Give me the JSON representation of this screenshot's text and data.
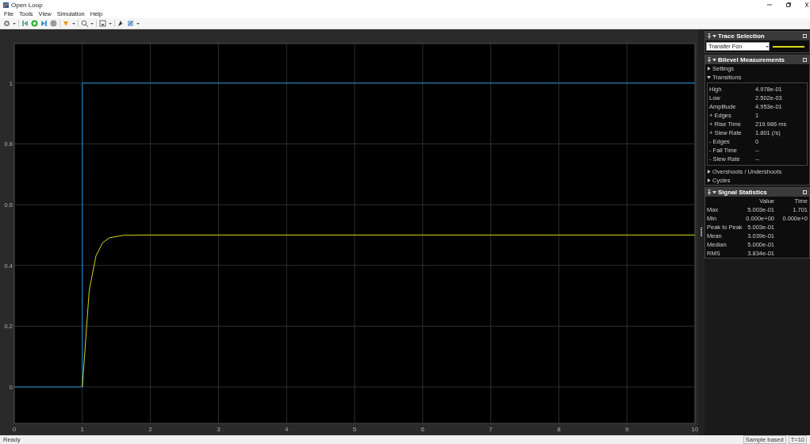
{
  "window": {
    "title": "Open Loop"
  },
  "menu": [
    "File",
    "Tools",
    "View",
    "Simulation",
    "Help"
  ],
  "plot": {
    "chart_data": {
      "type": "line",
      "grid": true,
      "x": [
        0,
        0.999,
        1,
        1.1,
        1.2,
        1.3,
        1.4,
        1.6,
        2,
        10
      ],
      "xlim": [
        0,
        10
      ],
      "ylim": [
        -0.12,
        1.13
      ],
      "xticks": [
        0,
        1,
        2,
        3,
        4,
        5,
        6,
        7,
        8,
        9,
        10
      ],
      "yticks": [
        0,
        0.2,
        0.4,
        0.6,
        0.8,
        1
      ],
      "series": [
        {
          "color": "#1f8fd8",
          "values": [
            0,
            0,
            1,
            1,
            1,
            1,
            1,
            1,
            1,
            1
          ]
        },
        {
          "color": "#d6d61a",
          "values": [
            null,
            null,
            0,
            0.316,
            0.432,
            0.475,
            0.491,
            0.499,
            0.5,
            0.5
          ]
        }
      ]
    }
  },
  "trace_selection": {
    "title": "Trace Selection",
    "value": "Transfer Fcn"
  },
  "bilevel": {
    "title": "Bilevel Measurements",
    "sections": [
      {
        "label": "Settings",
        "expanded": false
      },
      {
        "label": "Transitions",
        "expanded": true,
        "rows": [
          {
            "label": "High",
            "value": "4.978e-01"
          },
          {
            "label": "Low",
            "value": "2.502e-03"
          },
          {
            "label": "Amplitude",
            "value": "4.953e-01"
          },
          {
            "label": "+ Edges",
            "value": "1"
          },
          {
            "label": "+ Rise Time",
            "value": "219.986 ms"
          },
          {
            "label": "+ Slew Rate",
            "value": "1.801 (/s)"
          },
          {
            "label": "- Edges",
            "value": "0"
          },
          {
            "label": "- Fall Time",
            "value": "--"
          },
          {
            "label": "- Slew Rate",
            "value": "--"
          }
        ]
      },
      {
        "label": "Overshoots / Undershoots",
        "expanded": false
      },
      {
        "label": "Cycles",
        "expanded": false
      }
    ]
  },
  "signal_statistics": {
    "title": "Signal Statistics",
    "columns": [
      "Value",
      "Time"
    ],
    "rows": [
      {
        "label": "Max",
        "value": "5.003e-01",
        "time": "1.701"
      },
      {
        "label": "Min",
        "value": "0.000e+00",
        "time": "0.000e+0"
      },
      {
        "label": "Peak to Peak",
        "value": "5.003e-01"
      },
      {
        "label": "Mean",
        "value": "3.039e-01"
      },
      {
        "label": "Median",
        "value": "5.000e-01"
      },
      {
        "label": "RMS",
        "value": "3.834e-01"
      }
    ]
  },
  "status_bar": {
    "status": "Ready",
    "mode": "Sample based",
    "time": "T=10"
  }
}
